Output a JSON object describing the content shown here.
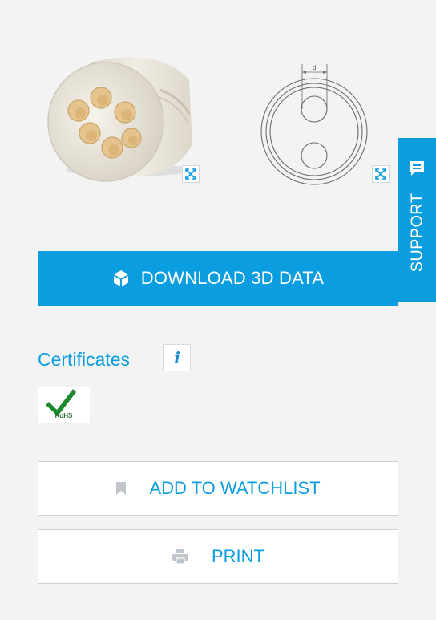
{
  "actions": {
    "download_label": "DOWNLOAD 3D DATA",
    "watchlist_label": "ADD TO WATCHLIST",
    "print_label": "PRINT"
  },
  "support": {
    "label": "SUPPORT"
  },
  "certificates": {
    "title": "Certificates",
    "info_glyph": "i",
    "badges": [
      {
        "name": "RoHS",
        "text": "RoHS"
      }
    ]
  },
  "drawing": {
    "dimension_label": "d"
  },
  "icons": {
    "expand": "expand-arrows-icon",
    "download": "cube-icon",
    "watchlist": "bookmark-icon",
    "print": "printer-icon",
    "support": "chat-bubble-icon",
    "info": "info-icon",
    "rohs_check": "checkmark-icon"
  },
  "colors": {
    "accent": "#0a9de0",
    "background": "#f3f3f3",
    "border": "#cfcfcf",
    "product": "#ece7dc",
    "hole": "#e8c896",
    "icon_gray": "#bfc5ca"
  }
}
